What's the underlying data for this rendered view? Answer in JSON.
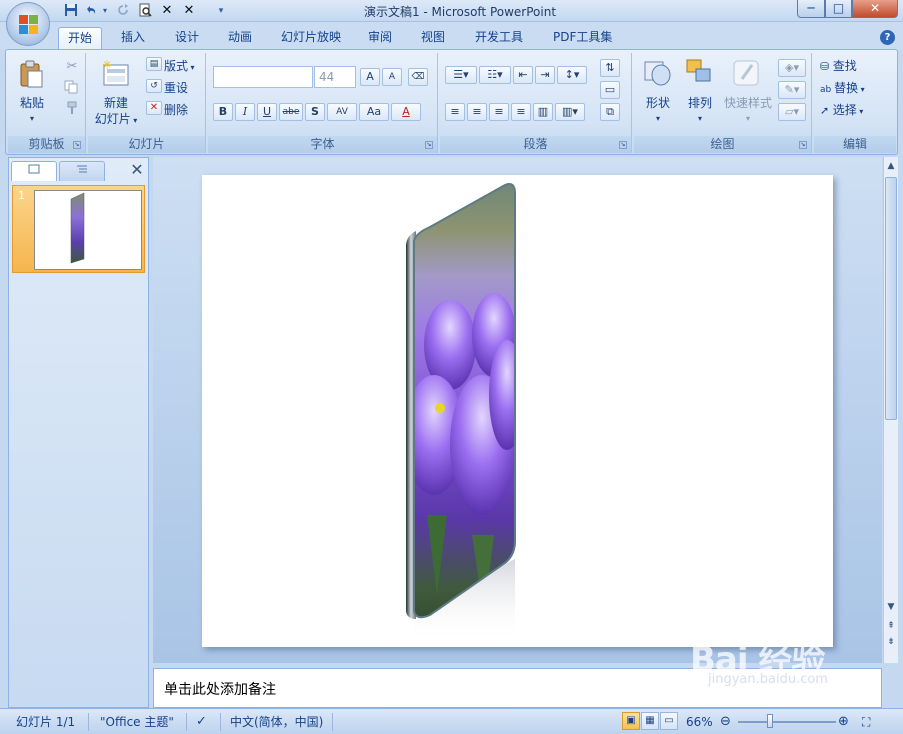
{
  "window": {
    "title": "演示文稿1 - Microsoft PowerPoint",
    "minimize_glyph": "─",
    "maximize_glyph": "□",
    "close_glyph": "✕"
  },
  "quick_access": {
    "save_icon": "save-icon",
    "undo_icon": "undo-icon",
    "redo_icon": "redo-icon",
    "preview_icon": "print-preview-icon",
    "x1_icon": "x-icon",
    "x2_icon": "x-icon",
    "customize_glyph": "▾"
  },
  "tabs": [
    "开始",
    "插入",
    "设计",
    "动画",
    "幻灯片放映",
    "审阅",
    "视图",
    "开发工具",
    "PDF工具集"
  ],
  "help_glyph": "?",
  "ribbon": {
    "clipboard": {
      "paste_label": "粘贴",
      "group_label": "剪贴板"
    },
    "slides": {
      "new_slide_label_1": "新建",
      "new_slide_label_2": "幻灯片",
      "layout_label": "版式",
      "reset_label": "重设",
      "delete_label": "删除",
      "group_label": "幻灯片"
    },
    "font": {
      "font_name_value": "",
      "font_size_value": "44",
      "bold": "B",
      "italic": "I",
      "underline": "U",
      "strike": "abe",
      "shadow": "S",
      "spacing": "AV",
      "case": "Aa",
      "color": "A",
      "grow": "A",
      "shrink": "A",
      "group_label": "字体"
    },
    "paragraph": {
      "group_label": "段落"
    },
    "drawing": {
      "shapes_label": "形状",
      "arrange_label": "排列",
      "quick_styles_label": "快速样式",
      "group_label": "绘图"
    },
    "editing": {
      "find_label": "查找",
      "replace_label": "替换",
      "select_label": "选择",
      "group_label": "编辑"
    }
  },
  "left_pane": {
    "slide_number": "1",
    "close_glyph": "✕"
  },
  "notes": {
    "placeholder": "单击此处添加备注"
  },
  "watermark": {
    "text": "Bai 经验",
    "url": "jingyan.baidu.com"
  },
  "status_bar": {
    "slide_info": "幻灯片 1/1",
    "theme": "\"Office 主题\"",
    "language": "中文(简体，中国)",
    "zoom": "66%",
    "zoom_fraction": 0.66
  },
  "colors": {
    "accent": "#15428b",
    "ribbon_bg": "#d4e3f5",
    "selected_thumb": "#f5b54e",
    "office_logo": [
      "#e14f24",
      "#7bb244",
      "#2c8fd6",
      "#f3b51c"
    ]
  }
}
